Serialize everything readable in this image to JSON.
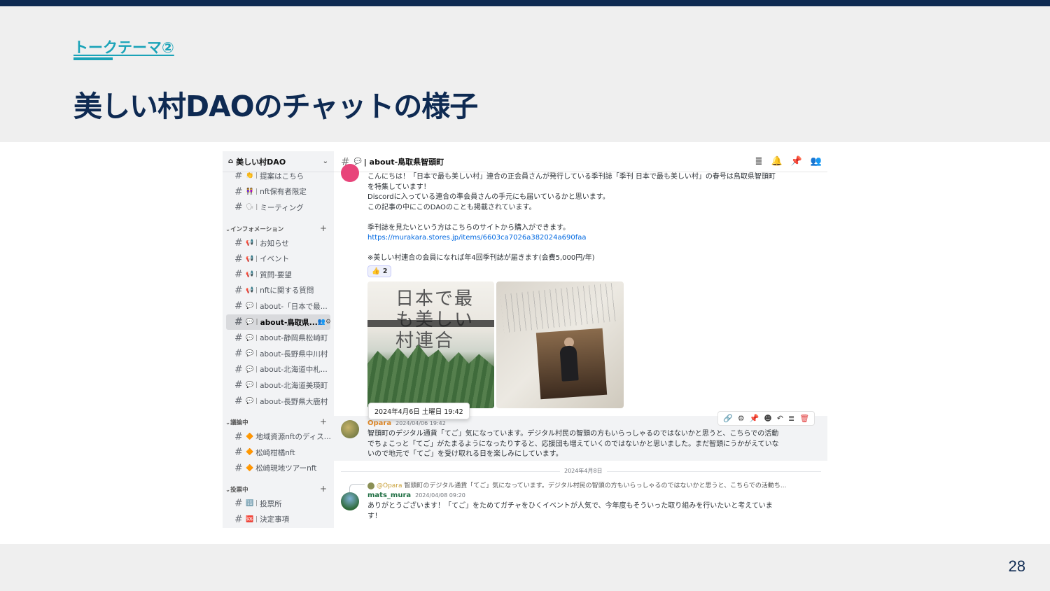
{
  "slide": {
    "eyebrow": "トークテーマ②",
    "title": "美しい村DAOのチャットの様子",
    "page_number": "28"
  },
  "server": {
    "name": "美しい村DAO",
    "icon": "server-icon"
  },
  "channels": [
    {
      "type": "channel",
      "label": "提案はこちら",
      "emoji": "👏 |"
    },
    {
      "type": "channel",
      "label": "nft保有者限定",
      "emoji": "👭 |"
    },
    {
      "type": "channel",
      "label": "ミーティング",
      "emoji": "🗣 |"
    },
    {
      "type": "category",
      "label": "インフォメーション"
    },
    {
      "type": "channel",
      "label": "お知らせ",
      "emoji": "📢 |"
    },
    {
      "type": "channel",
      "label": "イベント",
      "emoji": "📢 |"
    },
    {
      "type": "channel",
      "label": "質問-要望",
      "emoji": "📢 |"
    },
    {
      "type": "channel",
      "label": "nftに関する質問",
      "emoji": "📢 |"
    },
    {
      "type": "channel",
      "label": "about-「日本で最...",
      "emoji": "💬 |"
    },
    {
      "type": "channel",
      "label": "about-鳥取県...",
      "emoji": "💬 |",
      "active": true
    },
    {
      "type": "channel",
      "label": "about-静岡県松崎町",
      "emoji": "💬 |"
    },
    {
      "type": "channel",
      "label": "about-長野県中川村",
      "emoji": "💬 |"
    },
    {
      "type": "channel",
      "label": "about-北海道中札...",
      "emoji": "💬 |"
    },
    {
      "type": "channel",
      "label": "about-北海道美瑛町",
      "emoji": "💬 |"
    },
    {
      "type": "channel",
      "label": "about-長野県大鹿村",
      "emoji": "💬 |"
    },
    {
      "type": "category",
      "label": "議論中"
    },
    {
      "type": "channel",
      "label": "地域資源nftのディス...",
      "emoji": "🔶"
    },
    {
      "type": "channel",
      "label": "松崎柑橘nft",
      "emoji": "🔶"
    },
    {
      "type": "channel",
      "label": "松崎現地ツアーnft",
      "emoji": "🔶"
    },
    {
      "type": "category",
      "label": "投票中"
    },
    {
      "type": "channel",
      "label": "投票所",
      "emoji": "🔢 |"
    },
    {
      "type": "channel",
      "label": "決定事項",
      "emoji": "🆘 |"
    }
  ],
  "channel_header": {
    "name": "| about-鳥取県智頭町",
    "emoji": "💬"
  },
  "message1": {
    "lines": [
      "こんにちは！「日本で最も美しい村」連合の正会員さんが発行している季刊誌「季刊 日本で最も美しい村」の春号は鳥取県智頭町",
      "を特集しています！",
      "Discordに入っている連合の準会員さんの手元にも届いているかと思います。",
      "この記事の中にこのDAOのことも掲載されています。",
      "",
      "季刊誌を見たいという方はこちらのサイトから購入ができます。"
    ],
    "link": "https://murakara.stores.jp/items/6603ca7026a382024a690faa",
    "note": "※美しい村連合の会員になれば年4回季刊誌が届きます(会費5,000円/年)",
    "reaction_emoji": "👍",
    "reaction_count": "2",
    "image_title": "日本で最も美しい村連合"
  },
  "tooltip": "2024年4月6日 土曜日 19:42",
  "message2": {
    "author": "Opara",
    "author_color": "#e08a2a",
    "time": "2024/04/06 19:42",
    "lines": [
      "智頭町のデジタル通貨「てご」気になっています。デジタル村民の智頭の方もいらっしゃるのではないかと思うと、こちらでの活動",
      "でちょこっと「てご」がたまるようになったりすると、応援団も増えていくのではないかと思いました。まだ智頭にうかがえていな",
      "いので地元で「てご」を受け取れる日を楽しみにしています。"
    ]
  },
  "date_divider": "2024年4月8日",
  "reply_ref": {
    "mention": "@Opara",
    "text": " 智頭町のデジタル通貨「てご」気になっています。デジタル村民の智頭の方もいらっしゃるのではないかと思うと、こちらでの活動ち..."
  },
  "message3": {
    "author": "mats_mura",
    "time": "2024/04/08 09:20",
    "lines": [
      "ありがとうございます！「てご」をためてガチャをひくイベントが人気で、今年度もそういった取り組みを行いたいと考えていま",
      "す！"
    ]
  },
  "colors": {
    "navy": "#0e2a52",
    "teal": "#1aa3b8",
    "link": "#0068e0"
  }
}
